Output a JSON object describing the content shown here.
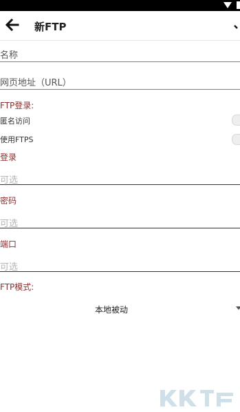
{
  "appbar": {
    "title": "新FTP"
  },
  "fields": {
    "name_placeholder": "名称",
    "url_placeholder": "网页地址（URL）"
  },
  "login_section": {
    "label": "FTP登录:",
    "anonymous_label": "匿名访问",
    "ftps_label": "使用FTPS"
  },
  "inputs": [
    {
      "label": "登录",
      "placeholder": "可选"
    },
    {
      "label": "密码",
      "placeholder": "可选"
    },
    {
      "label": "端口",
      "placeholder": "可选"
    }
  ],
  "mode_section": {
    "label": "FTP模式:",
    "selected": "本地被动"
  },
  "watermark": {
    "text": "KK下载"
  },
  "colors": {
    "accent_label": "#8b2f2f",
    "underline": "#333333",
    "statusbar": "#000000"
  }
}
